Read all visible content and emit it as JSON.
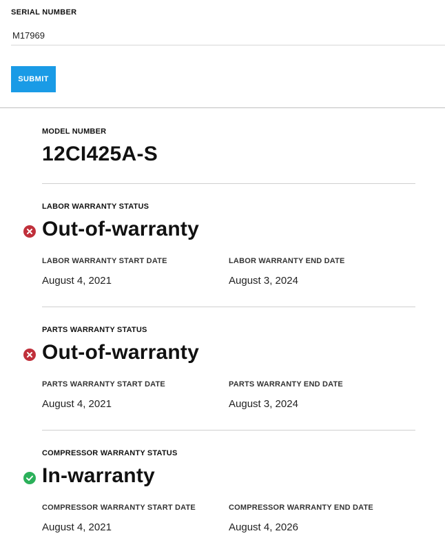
{
  "form": {
    "serial_label": "SERIAL NUMBER",
    "serial_value": "M17969",
    "submit_label": "SUBMIT"
  },
  "model": {
    "label": "MODEL NUMBER",
    "value": "12CI425A-S"
  },
  "warranties": [
    {
      "status_label": "LABOR WARRANTY STATUS",
      "status": "Out-of-warranty",
      "status_icon": "error-x-icon",
      "status_color": "#c0303b",
      "start_label": "LABOR WARRANTY START DATE",
      "start_date": "August 4, 2021",
      "end_label": "LABOR WARRANTY END DATE",
      "end_date": "August 3, 2024"
    },
    {
      "status_label": "PARTS WARRANTY STATUS",
      "status": "Out-of-warranty",
      "status_icon": "error-x-icon",
      "status_color": "#c0303b",
      "start_label": "PARTS WARRANTY START DATE",
      "start_date": "August 4, 2021",
      "end_label": "PARTS WARRANTY END DATE",
      "end_date": "August 3, 2024"
    },
    {
      "status_label": "COMPRESSOR WARRANTY STATUS",
      "status": "In-warranty",
      "status_icon": "check-icon",
      "status_color": "#2bb05a",
      "start_label": "COMPRESSOR WARRANTY START DATE",
      "start_date": "August 4, 2021",
      "end_label": "COMPRESSOR WARRANTY END DATE",
      "end_date": "August 4, 2026"
    }
  ],
  "colors": {
    "submit_bg": "#1a9be6",
    "error": "#c0303b",
    "success": "#2bb05a"
  }
}
